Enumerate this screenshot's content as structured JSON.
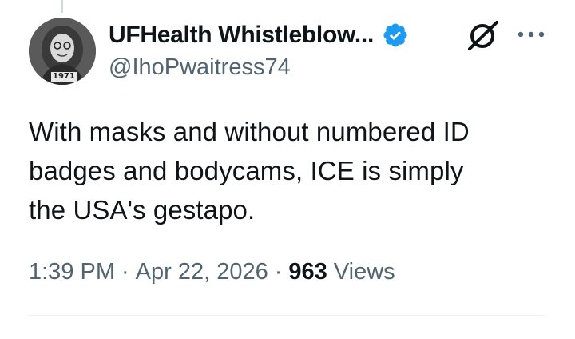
{
  "author": {
    "display_name": "UFHealth Whistleblow...",
    "handle": "@IhoPwaitress74",
    "avatar_caption": "1971",
    "verified": true
  },
  "tweet": {
    "text_lines": [
      "With masks and without numbered ID",
      "badges and bodycams, ICE is simply",
      "the USA's gestapo."
    ]
  },
  "meta": {
    "time": "1:39 PM",
    "separator": "·",
    "date": "Apr 22, 2026",
    "views_count": "963",
    "views_label": "Views"
  },
  "icons": {
    "verified": "verified-badge-icon",
    "grok": "grok-icon",
    "more": "more-options-icon"
  },
  "colors": {
    "primary_text": "#0f1419",
    "secondary_text": "#536471",
    "verified_blue": "#1d9bf0",
    "divider": "#eff3f4"
  }
}
